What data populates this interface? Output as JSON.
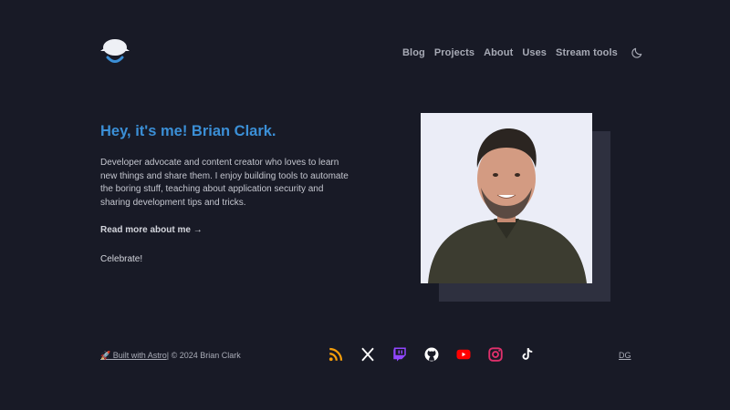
{
  "nav": {
    "items": [
      {
        "label": "Blog"
      },
      {
        "label": "Projects"
      },
      {
        "label": "About"
      },
      {
        "label": "Uses"
      },
      {
        "label": "Stream tools"
      }
    ],
    "theme_icon": "moon-icon"
  },
  "hero": {
    "title": "Hey, it's me! Brian Clark.",
    "description": "Developer advocate and content creator who loves to learn new things and share them. I enjoy building tools to automate the boring stuff, teaching about application security and sharing development tips and tricks.",
    "read_more": "Read more about me →",
    "celebrate": "Celebrate!"
  },
  "footer": {
    "built_with": "🚀 Built with Astro",
    "separator": "|",
    "copyright": " © 2024 Brian Clark",
    "right_link": "DG",
    "socials": [
      {
        "icon": "rss-icon",
        "color": "#f59e0b"
      },
      {
        "icon": "x-icon",
        "color": "#ffffff"
      },
      {
        "icon": "twitch-icon",
        "color": "#9146ff"
      },
      {
        "icon": "github-icon",
        "color": "#ffffff"
      },
      {
        "icon": "youtube-icon",
        "color": "#ff0000"
      },
      {
        "icon": "instagram-icon",
        "color": "#e1306c"
      },
      {
        "icon": "tiktok-icon",
        "color": "#ffffff"
      }
    ]
  },
  "colors": {
    "background": "#181a26",
    "accent": "#3b8fd6"
  }
}
